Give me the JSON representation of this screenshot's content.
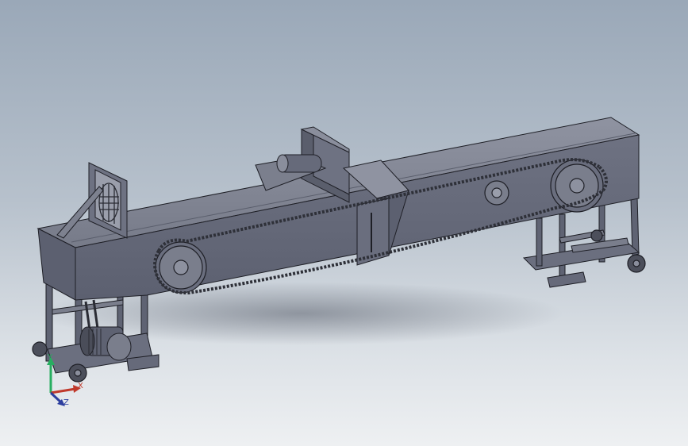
{
  "viewport": {
    "background_top": "#9aa8b8",
    "background_bottom": "#eef0f2"
  },
  "model": {
    "body_color": "#6b6f7f",
    "body_light": "#8a8e9c",
    "body_dark": "#50535f",
    "edge_color": "#1e1f26",
    "chain_color": "#3a3c46"
  },
  "triad": {
    "x_label": "X",
    "y_label": "Y",
    "z_label": "Z",
    "x_color": "#c0392b",
    "y_color": "#27ae60",
    "z_color": "#2c3e9e"
  }
}
